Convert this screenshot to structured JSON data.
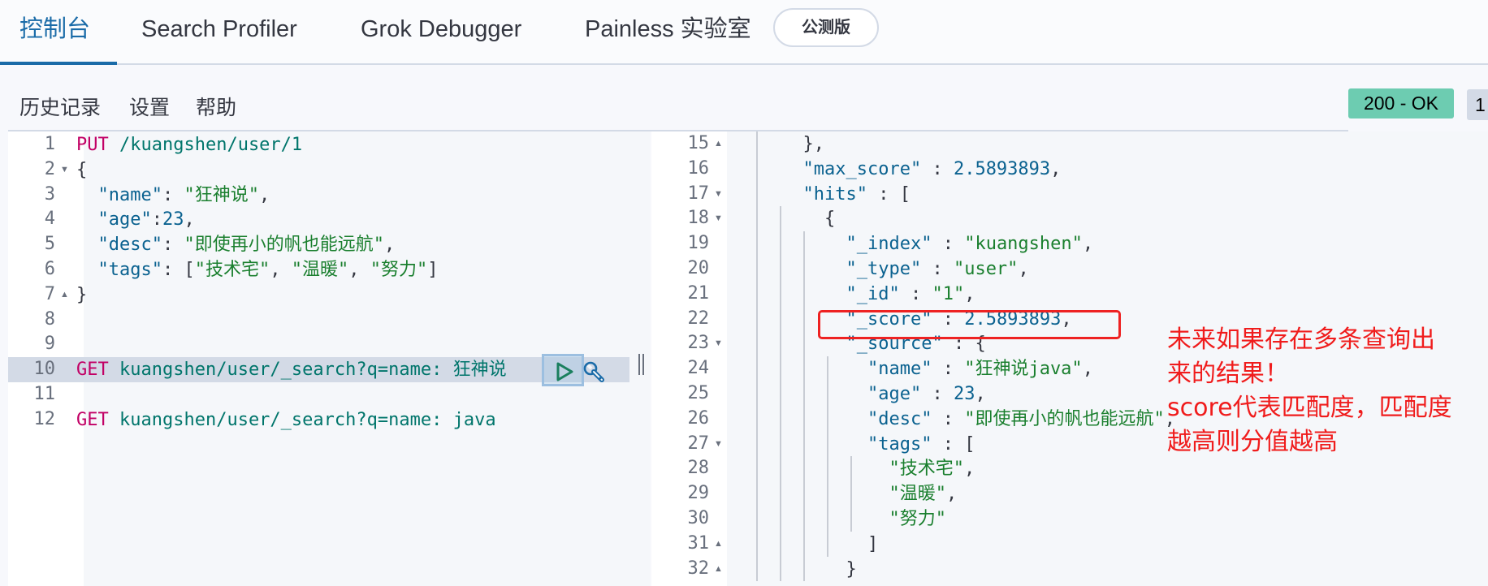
{
  "tabs": [
    {
      "label": "控制台",
      "active": true
    },
    {
      "label": "Search Profiler",
      "active": false
    },
    {
      "label": "Grok Debugger",
      "active": false
    },
    {
      "label": "Painless 实验室",
      "active": false
    }
  ],
  "beta_badge": "公测版",
  "toolbar": {
    "history": "历史记录",
    "settings": "设置",
    "help": "帮助"
  },
  "response_status": {
    "status": "200 - OK",
    "status_color": "#6dccb1",
    "time_partial": "1"
  },
  "request_editor": {
    "lines": [
      {
        "n": "1",
        "fold": "",
        "text": "PUT /kuangshen/user/1"
      },
      {
        "n": "2",
        "fold": "down",
        "text": "{"
      },
      {
        "n": "3",
        "fold": "",
        "text": "  \"name\": \"狂神说\","
      },
      {
        "n": "4",
        "fold": "",
        "text": "  \"age\":23,"
      },
      {
        "n": "5",
        "fold": "",
        "text": "  \"desc\": \"即使再小的帆也能远航\","
      },
      {
        "n": "6",
        "fold": "",
        "text": "  \"tags\": [\"技术宅\", \"温暖\", \"努力\"]"
      },
      {
        "n": "7",
        "fold": "up",
        "text": "}"
      },
      {
        "n": "8",
        "fold": "",
        "text": ""
      },
      {
        "n": "9",
        "fold": "",
        "text": ""
      },
      {
        "n": "10",
        "fold": "",
        "text": "GET kuangshen/user/_search?q=name: 狂神说"
      },
      {
        "n": "11",
        "fold": "",
        "text": ""
      },
      {
        "n": "12",
        "fold": "",
        "text": "GET kuangshen/user/_search?q=name: java"
      }
    ],
    "active_line": "10"
  },
  "response_editor": {
    "lines": [
      {
        "n": "15",
        "fold": "up",
        "text": "  },"
      },
      {
        "n": "16",
        "fold": "",
        "text": "  \"max_score\" : 2.5893893,"
      },
      {
        "n": "17",
        "fold": "down",
        "text": "  \"hits\" : ["
      },
      {
        "n": "18",
        "fold": "down",
        "text": "    {"
      },
      {
        "n": "19",
        "fold": "",
        "text": "      \"_index\" : \"kuangshen\","
      },
      {
        "n": "20",
        "fold": "",
        "text": "      \"_type\" : \"user\","
      },
      {
        "n": "21",
        "fold": "",
        "text": "      \"_id\" : \"1\","
      },
      {
        "n": "22",
        "fold": "",
        "text": "      \"_score\" : 2.5893893,"
      },
      {
        "n": "23",
        "fold": "down",
        "text": "      \"_source\" : {"
      },
      {
        "n": "24",
        "fold": "",
        "text": "        \"name\" : \"狂神说java\","
      },
      {
        "n": "25",
        "fold": "",
        "text": "        \"age\" : 23,"
      },
      {
        "n": "26",
        "fold": "",
        "text": "        \"desc\" : \"即使再小的帆也能远航\","
      },
      {
        "n": "27",
        "fold": "down",
        "text": "        \"tags\" : ["
      },
      {
        "n": "28",
        "fold": "",
        "text": "          \"技术宅\","
      },
      {
        "n": "29",
        "fold": "",
        "text": "          \"温暖\","
      },
      {
        "n": "30",
        "fold": "",
        "text": "          \"努力\""
      },
      {
        "n": "31",
        "fold": "up",
        "text": "        ]"
      },
      {
        "n": "32",
        "fold": "up",
        "text": "      }"
      }
    ]
  },
  "annotation": {
    "lines": [
      "未来如果存在多条查询出",
      "来的结果！",
      "score代表匹配度，匹配度",
      "越高则分值越高"
    ],
    "color": "#f01c1c"
  },
  "icons": {
    "run": "play-icon",
    "actions": "wrench-icon"
  }
}
